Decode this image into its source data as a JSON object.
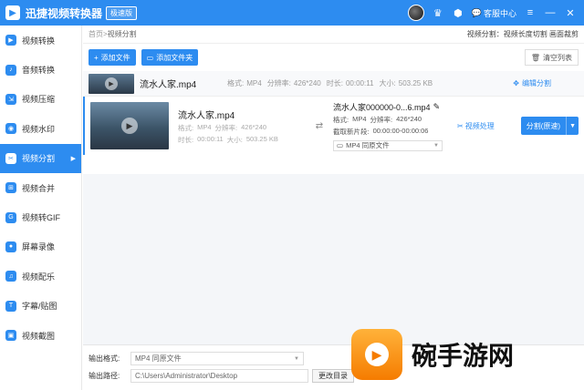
{
  "app": {
    "title": "迅捷视频转换器",
    "edition": "极速版",
    "message_center": "客服中心"
  },
  "sidebar": {
    "items": [
      {
        "label": "视频转换",
        "icon": "video-convert-icon"
      },
      {
        "label": "音频转换",
        "icon": "audio-convert-icon"
      },
      {
        "label": "视频压缩",
        "icon": "video-compress-icon"
      },
      {
        "label": "视频水印",
        "icon": "video-watermark-icon"
      },
      {
        "label": "视频分割",
        "icon": "video-split-icon"
      },
      {
        "label": "视频合并",
        "icon": "video-merge-icon"
      },
      {
        "label": "视频转GIF",
        "icon": "video-gif-icon"
      },
      {
        "label": "屏幕录像",
        "icon": "screen-record-icon"
      },
      {
        "label": "视频配乐",
        "icon": "video-music-icon"
      },
      {
        "label": "字幕/贴图",
        "icon": "subtitle-icon"
      },
      {
        "label": "视频截图",
        "icon": "video-screenshot-icon"
      }
    ],
    "active_index": 4
  },
  "breadcrumb": {
    "home": "首页",
    "separator": " > ",
    "current": "视频分割",
    "right_text": "视频分割：视频长度切割 画面裁剪"
  },
  "toolbar": {
    "add_file": "添加文件",
    "add_folder": "添加文件夹",
    "clear_list": "清空列表"
  },
  "file_collapsed": {
    "name": "流水人家.mp4",
    "format_label": "格式:",
    "format": "MP4",
    "resolution_label": "分辨率:",
    "resolution": "426*240",
    "duration_label": "时长:",
    "duration": "00:00:11",
    "size_label": "大小:",
    "size": "503.25 KB",
    "action": "编辑分割"
  },
  "file_expanded": {
    "name": "流水人家.mp4",
    "format_label": "格式:",
    "format": "MP4",
    "resolution_label": "分辨率:",
    "resolution": "426*240",
    "duration_label": "时长:",
    "duration": "00:00:11",
    "size_label": "大小:",
    "size": "503.25 KB",
    "output_name": "流水人家000000-0...6.mp4",
    "out_format_label": "格式:",
    "out_format": "MP4",
    "out_resolution_label": "分辨率:",
    "out_resolution": "426*240",
    "clip_label": "截取新片段:",
    "clip_range": "00:00:00-00:00:06",
    "format_select": "MP4  同原文件",
    "process_label": "视频处理",
    "split_button": "分割(原速)"
  },
  "bottom": {
    "output_format_label": "输出格式:",
    "output_format_value": "MP4  同原文件",
    "output_path_label": "输出路径:",
    "output_path_value": "C:\\Users\\Administrator\\Desktop",
    "change_dir": "更改目录"
  },
  "watermark": {
    "text": "碗手游网"
  }
}
